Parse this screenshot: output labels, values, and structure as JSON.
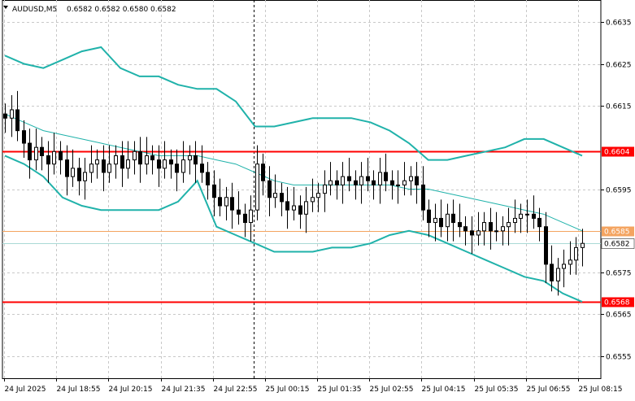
{
  "header": {
    "dropdown_icon": "triangle-down-icon",
    "symbol_timeframe": "AUDUSD,M5",
    "ohlc": "0.6582 0.6582 0.6580 0.6582"
  },
  "colors": {
    "background": "#ffffff",
    "grid": "#c8c8c8",
    "candle": "#000000",
    "bollinger": "#20b2aa",
    "moving_average": "#20b2aa",
    "resistance_line": "#ff0000",
    "support_line": "#ff0000",
    "level_line": "#f4a460",
    "bid_line": "#a9d9d6",
    "axis": "#000000"
  },
  "chart_data": {
    "type": "candlestick",
    "symbol": "AUDUSD",
    "timeframe": "M5",
    "grid": true,
    "ylim": [
      0.65497,
      0.66403
    ],
    "y_ticks": [
      "0.6635",
      "0.6625",
      "0.6615",
      "0.6595",
      "0.6575",
      "0.6565",
      "0.6555"
    ],
    "x_ticks": [
      "24 Jul 2025",
      "24 Jul 18:55",
      "24 Jul 20:15",
      "24 Jul 21:35",
      "24 Jul 22:55",
      "25 Jul 00:15",
      "25 Jul 01:35",
      "25 Jul 02:55",
      "25 Jul 04:15",
      "25 Jul 05:35",
      "25 Jul 06:55",
      "25 Jul 08:15"
    ],
    "horizontal_lines": [
      {
        "name": "resistance",
        "value": 0.6604,
        "label": "0.6604",
        "color": "#ff0000"
      },
      {
        "name": "level",
        "value": 0.6585,
        "label": "0.6585",
        "color": "#f4a460"
      },
      {
        "name": "current-price",
        "value": 0.6582,
        "label": "0.6582",
        "color": "#a9d9d6"
      },
      {
        "name": "support",
        "value": 0.6568,
        "label": "0.6568",
        "color": "#ff0000"
      }
    ],
    "vertical_marker": {
      "time": "24 Jul 23:55"
    },
    "close_series": [
      0.6612,
      0.6614,
      0.6609,
      0.6606,
      0.6602,
      0.6605,
      0.6603,
      0.6601,
      0.6604,
      0.6602,
      0.6598,
      0.66,
      0.6597,
      0.6599,
      0.6601,
      0.6602,
      0.6599,
      0.6601,
      0.6603,
      0.66,
      0.6602,
      0.6604,
      0.6601,
      0.6603,
      0.6602,
      0.66,
      0.6602,
      0.6601,
      0.6599,
      0.6602,
      0.6603,
      0.6601,
      0.6599,
      0.6596,
      0.6593,
      0.6591,
      0.6593,
      0.659,
      0.6589,
      0.6587,
      0.659,
      0.6601,
      0.6597,
      0.6593,
      0.6594,
      0.6592,
      0.659,
      0.6591,
      0.6589,
      0.6592,
      0.6593,
      0.6594,
      0.6596,
      0.6597,
      0.6596,
      0.6598,
      0.6597,
      0.6596,
      0.6598,
      0.6597,
      0.6596,
      0.6599,
      0.6597,
      0.6596,
      0.6596,
      0.6597,
      0.6598,
      0.6596,
      0.659,
      0.6587,
      0.6588,
      0.6586,
      0.6589,
      0.6587,
      0.6586,
      0.6585,
      0.6584,
      0.6585,
      0.6587,
      0.6585,
      0.6585,
      0.6586,
      0.6587,
      0.6588,
      0.6589,
      0.6589,
      0.6588,
      0.6586,
      0.6577,
      0.6573,
      0.6576,
      0.6577,
      0.6578,
      0.6581,
      0.6582
    ],
    "bollinger_upper": [
      0.6627,
      0.6625,
      0.6624,
      0.6626,
      0.6628,
      0.6629,
      0.6624,
      0.6622,
      0.6622,
      0.662,
      0.6619,
      0.6619,
      0.6616,
      0.661,
      0.661,
      0.6611,
      0.6612,
      0.6612,
      0.6612,
      0.6611,
      0.6609,
      0.6606,
      0.6602,
      0.6602,
      0.6603,
      0.6604,
      0.6605,
      0.6607,
      0.6607,
      0.6605,
      0.6603
    ],
    "bollinger_middle": [
      0.6613,
      0.6611,
      0.6609,
      0.6608,
      0.6607,
      0.6606,
      0.6605,
      0.6604,
      0.6603,
      0.6603,
      0.6603,
      0.6602,
      0.6601,
      0.6599,
      0.6597,
      0.6596,
      0.6596,
      0.6596,
      0.6596,
      0.6596,
      0.6596,
      0.6595,
      0.6595,
      0.6594,
      0.6593,
      0.6592,
      0.6591,
      0.659,
      0.6589,
      0.6587,
      0.6585
    ],
    "bollinger_lower": [
      0.6603,
      0.6601,
      0.6598,
      0.6593,
      0.6591,
      0.659,
      0.659,
      0.659,
      0.659,
      0.6592,
      0.6597,
      0.6586,
      0.6584,
      0.6582,
      0.658,
      0.658,
      0.658,
      0.6581,
      0.6581,
      0.6582,
      0.6584,
      0.6585,
      0.6584,
      0.6582,
      0.658,
      0.6578,
      0.6576,
      0.6574,
      0.6573,
      0.657,
      0.6568
    ]
  }
}
